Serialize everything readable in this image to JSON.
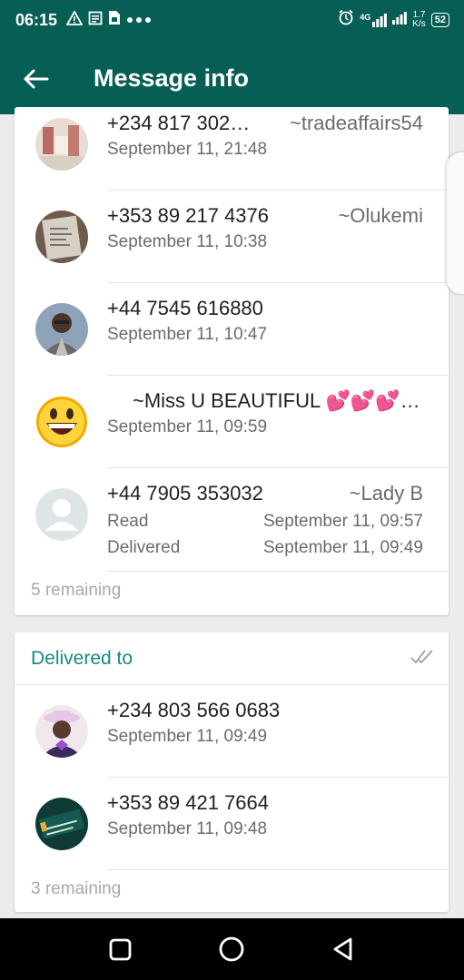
{
  "status_bar": {
    "time": "06:15",
    "network": "4G",
    "speed_value": "1.7",
    "speed_unit": "K/s",
    "battery": "52"
  },
  "app_bar": {
    "title": "Message info"
  },
  "read_section": {
    "rows": [
      {
        "name": "+234 817 302…",
        "alias": "~tradeaffairs54",
        "date": "September 11, 21:48"
      },
      {
        "name": "+353 89 217 4376",
        "alias": "~Olukemi",
        "date": "September 11, 10:38"
      },
      {
        "name": "+44 7545 616880",
        "alias": "",
        "date": "September 11, 10:47"
      },
      {
        "name": "~Miss U BEAUTIFUL 💕💕💕…",
        "alias": "",
        "date": "September 11, 09:59"
      },
      {
        "name": "+44 7905 353032",
        "alias": "~Lady B",
        "read_label": "Read",
        "read_date": "September 11, 09:57",
        "delivered_label": "Delivered",
        "delivered_date": "September 11, 09:49"
      }
    ],
    "remaining": "5 remaining"
  },
  "delivered_section": {
    "title": "Delivered to",
    "rows": [
      {
        "name": "+234 803 566 0683",
        "date": "September 11, 09:49"
      },
      {
        "name": "+353 89 421 7664",
        "date": "September 11, 09:48"
      }
    ],
    "remaining": "3 remaining"
  },
  "colors": {
    "primary": "#075e54",
    "accent": "#128c7e",
    "tick": "#9e9e9e"
  }
}
